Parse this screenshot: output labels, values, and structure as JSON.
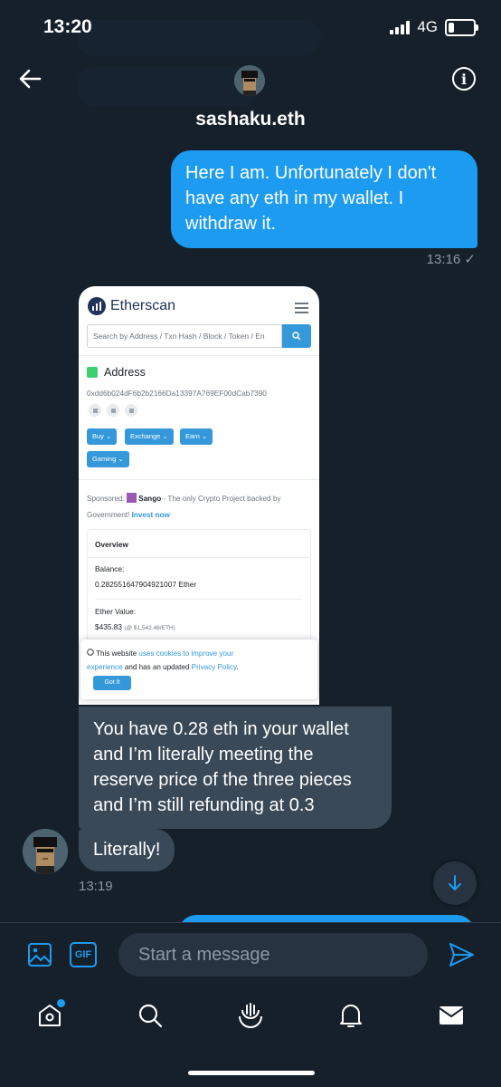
{
  "status_bar": {
    "time": "13:20",
    "network": "4G"
  },
  "header": {
    "contact_name": "sashaku.eth"
  },
  "messages": {
    "outgoing_1": {
      "text": "Here I am. Unfortunately I don't have any eth in my wallet. I withdraw it.",
      "time": "13:16 ✓"
    },
    "incoming_1": {
      "text": "You have 0.28 eth in your wallet and I’m literally meeting the reserve price of the three pieces and I’m still refunding at 0.3"
    },
    "incoming_2": {
      "text": "Literally!",
      "time": "13:19"
    }
  },
  "shared_screenshot": {
    "site_name": "Etherscan",
    "search_placeholder": "Search by Address / Txn Hash / Block / Token / En",
    "section_title": "Address",
    "address": "0xdd6b024dF6b2b2166Da13397A769EF00dCab7390",
    "buttons": [
      "Buy ⌄",
      "Exchange ⌄",
      "Earn ⌄",
      "Gaming ⌄"
    ],
    "sponsored_label": "Sponsored:",
    "sponsor_name": "Sango",
    "sponsor_text": " - The only Crypto Project backed by Government! ",
    "sponsor_link": "Invest now",
    "overview_title": "Overview",
    "balance_label": "Balance:",
    "balance_value": "0.282551647904921007 Ether",
    "ether_value_label": "Ether Value:",
    "ether_value": "$435.83",
    "ether_price": "(@ $1,542.48/ETH)",
    "cookie_text_1": "This website ",
    "cookie_link_1": "uses cookies to improve your experience",
    "cookie_text_2": " and has an updated ",
    "cookie_link_2": "Privacy Policy",
    "cookie_text_3": ".",
    "cookie_button": "Got It"
  },
  "composer": {
    "placeholder": "Start a message",
    "gif_label": "GIF"
  },
  "tabs": [
    "home-icon",
    "search-icon",
    "spaces-icon",
    "notifications-icon",
    "messages-icon"
  ],
  "colors": {
    "background": "#15202b",
    "accent": "#1d9bf0",
    "incoming_bubble": "#3a4957",
    "muted": "#8b98a5"
  }
}
